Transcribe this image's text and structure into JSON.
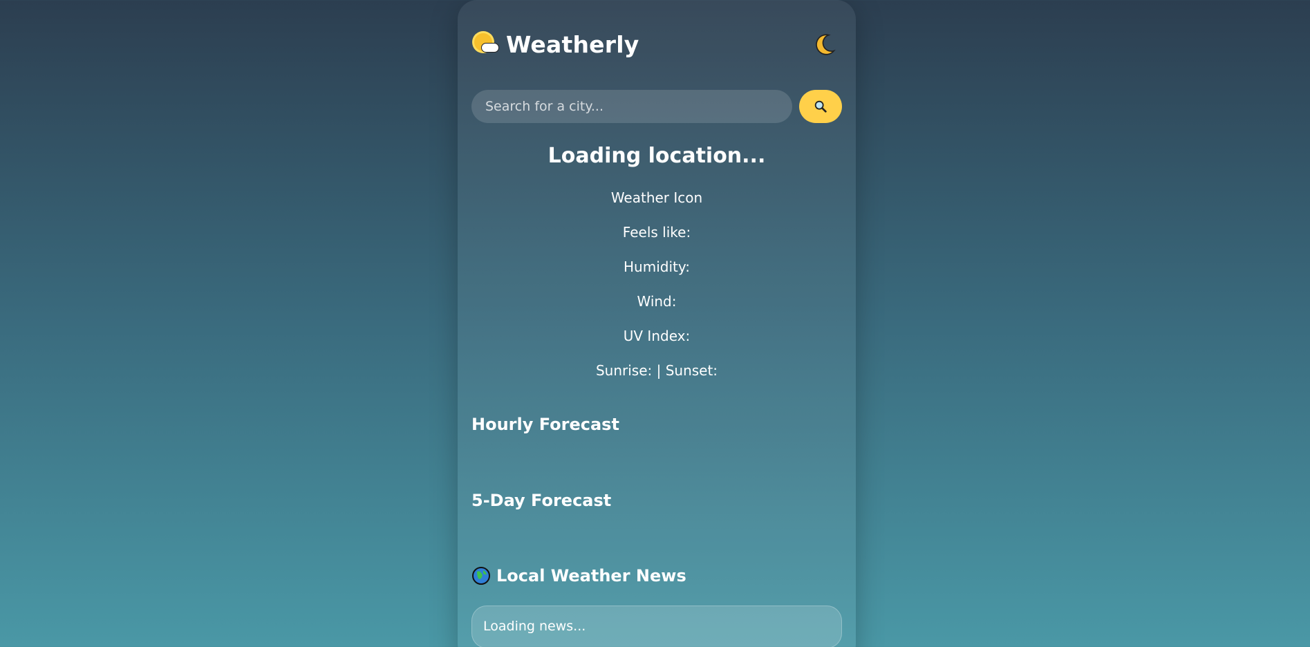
{
  "app": {
    "title": "Weatherly",
    "logo_icon": "sun-behind-cloud-icon",
    "theme_toggle_icon": "crescent-moon-icon"
  },
  "search": {
    "placeholder": "Search for a city...",
    "button_icon": "magnifying-glass-icon"
  },
  "current": {
    "location": "Loading location...",
    "weather_icon_alt": "Weather Icon",
    "feels_like": "Feels like:",
    "humidity": "Humidity:",
    "wind": "Wind:",
    "uv_index": "UV Index:",
    "sun_times": "Sunrise: | Sunset:"
  },
  "sections": {
    "hourly_title": "Hourly Forecast",
    "daily_title": "5-Day Forecast",
    "news_title": "Local Weather News",
    "news_icon": "globe-icon",
    "news_status": "Loading news..."
  },
  "colors": {
    "accent": "#ffd04a",
    "bg_top": "#2c3e50",
    "bg_bottom": "#4a98a6"
  }
}
